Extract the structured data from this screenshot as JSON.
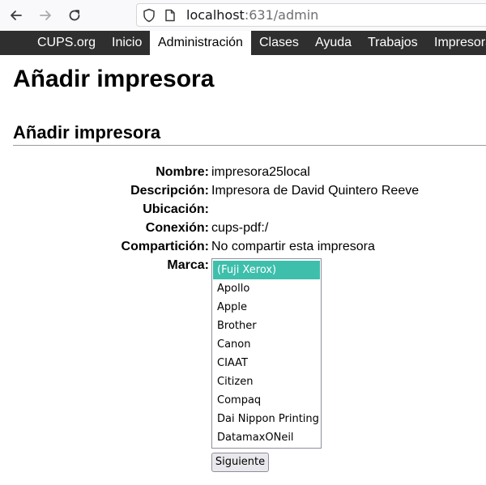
{
  "browser": {
    "url_host": "localhost",
    "url_path": ":631/admin"
  },
  "nav": {
    "items": [
      {
        "label": "CUPS.org"
      },
      {
        "label": "Inicio"
      },
      {
        "label": "Administración"
      },
      {
        "label": "Clases"
      },
      {
        "label": "Ayuda"
      },
      {
        "label": "Trabajos"
      },
      {
        "label": "Impresoras"
      }
    ],
    "active": "Administración"
  },
  "page": {
    "title": "Añadir impresora",
    "section_title": "Añadir impresora"
  },
  "form": {
    "nombre_label": "Nombre:",
    "nombre_value": "impresora25local",
    "descripcion_label": "Descripción:",
    "descripcion_value": "Impresora de David Quintero Reeve",
    "ubicacion_label": "Ubicación:",
    "ubicacion_value": "",
    "conexion_label": "Conexión:",
    "conexion_value": "cups-pdf:/",
    "comparticion_label": "Compartición:",
    "comparticion_value": "No compartir esta impresora",
    "marca_label": "Marca:",
    "marca_options": [
      "(Fuji Xerox)",
      "Apollo",
      "Apple",
      "Brother",
      "Canon",
      "CIAAT",
      "Citizen",
      "Compaq",
      "Dai Nippon Printing",
      "DatamaxONeil"
    ],
    "marca_selected": "(Fuji Xerox)",
    "submit_label": "Siguiente"
  }
}
